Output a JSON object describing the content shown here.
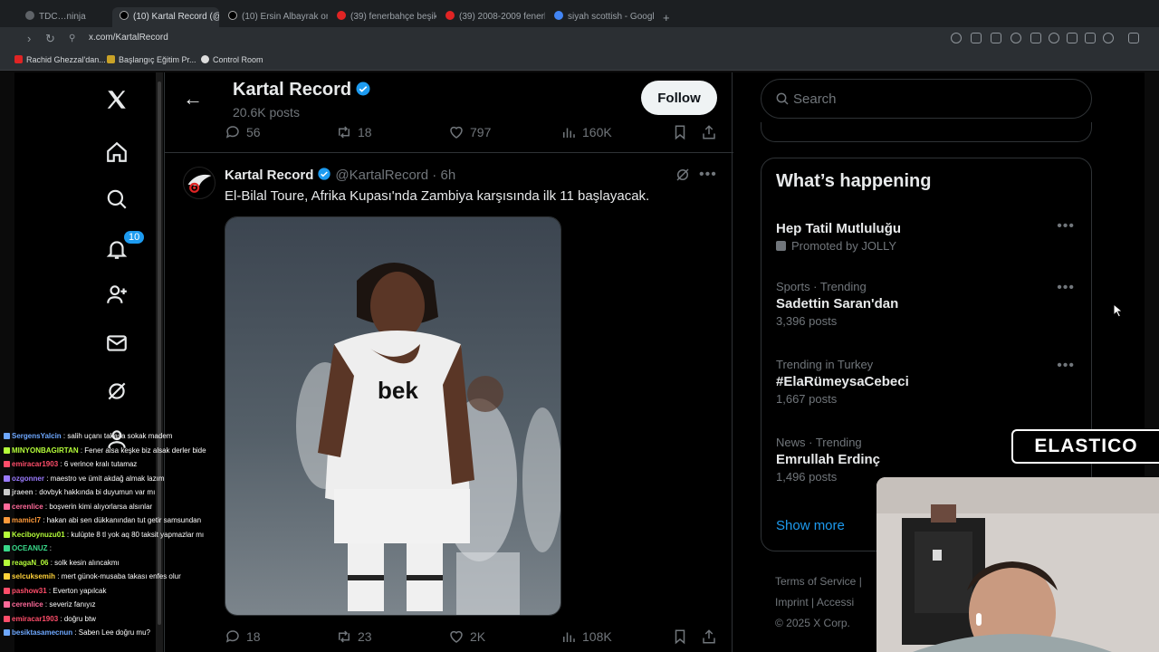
{
  "browser": {
    "tabs": [
      {
        "label": "TDC…ninja"
      },
      {
        "label": "(10) Kartal Record (@Ka…"
      },
      {
        "label": "(10) Ersin Albayrak on X…"
      },
      {
        "label": "(39) fenerbahçe beşikt…"
      },
      {
        "label": "(39) 2008-2009 fenerbah…"
      },
      {
        "label": "siyah scottish - Google…"
      }
    ],
    "url": "x.com/KartalRecord",
    "bookmarks": [
      "Rachid Ghezzal'dan...",
      "Başlangıç Eğitim Pr...",
      "Control Room"
    ]
  },
  "nav": {
    "notification_count": "10",
    "icons": [
      "x-logo-icon",
      "home-icon",
      "search-icon",
      "notifications-icon",
      "follow-icon",
      "messages-icon",
      "grok-icon",
      "profile-icon"
    ]
  },
  "header": {
    "title": "Kartal Record",
    "posts_count": "20.6K posts",
    "follow_label": "Follow"
  },
  "prev_post_actions": {
    "replies": "56",
    "reposts": "18",
    "likes": "797",
    "views": "160K"
  },
  "tweet": {
    "name": "Kartal Record",
    "handle": "@KartalRecord · 6h",
    "text": "El-Bilal Toure, Afrika Kupası'nda Zambiya karşısında ilk 11 başlayacak.",
    "actions": {
      "replies": "18",
      "reposts": "23",
      "likes": "2K",
      "views": "108K"
    }
  },
  "sidebar": {
    "search_placeholder": "Search",
    "whats_happening_title": "What’s happening",
    "trends": [
      {
        "meta": "",
        "label": "Hep Tatil Mutluluğu",
        "count": "Promoted by JOLLY"
      },
      {
        "meta": "Sports · Trending",
        "label": "Sadettin Saran'dan",
        "count": "3,396 posts"
      },
      {
        "meta": "Trending in Turkey",
        "label": "#ElaRümeysaCebeci",
        "count": "1,667 posts"
      },
      {
        "meta": "News · Trending",
        "label": "Emrullah Erdinç",
        "count": "1,496 posts"
      }
    ],
    "show_more": "Show more",
    "footer": {
      "terms": "Terms of Service",
      "imprint": "Imprint",
      "access": "Accessi",
      "copyright": "© 2025 X Corp."
    }
  },
  "stream": {
    "logo_text": "ELASTICO",
    "chat": [
      {
        "user": "SergensYalcin",
        "color": "#6ea8ff",
        "msg": ": salih uçanı takasa sokak madem"
      },
      {
        "user": "MINYONBAGIRTAN",
        "color": "#b6ff3a",
        "msg": ": Fener alsa keşke biz alsak derler bide"
      },
      {
        "user": "emiracar1903",
        "color": "#ff4d6a",
        "msg": ": 6 verince kralı tutamaz"
      },
      {
        "user": "ozgonner",
        "color": "#9b7bff",
        "msg": ": maestro ve ümit akdağ almak lazım"
      },
      {
        "user": "jraeen",
        "color": "#cccccc",
        "msg": ": dovbyk hakkında bi duyumun var mı"
      },
      {
        "user": "cerenlice",
        "color": "#ff6a9a",
        "msg": ": boşverin kimi alıyorlarsa alsınlar"
      },
      {
        "user": "mamicl7",
        "color": "#ff9a3a",
        "msg": ": hakan abi sen dükkanından tut getir samsundan"
      },
      {
        "user": "Keciboynuzu01",
        "color": "#b6ff3a",
        "msg": ": kulüpte 8 tl yok aq 80 taksit yapmazlar mı"
      },
      {
        "user": "OCEANUZ",
        "color": "#39d98a",
        "msg": ":"
      },
      {
        "user": "reagaN_06",
        "color": "#b6ff3a",
        "msg": ": solk kesin alıncakmı"
      },
      {
        "user": "selcuksemih",
        "color": "#ffd23a",
        "msg": ": mert günok-musaba takası enfes olur"
      },
      {
        "user": "pashow31",
        "color": "#ff4d6a",
        "msg": ": Everton yapılcak"
      },
      {
        "user": "cerenlice",
        "color": "#ff6a9a",
        "msg": ": severiz fanıyız"
      },
      {
        "user": "emiracar1903",
        "color": "#ff4d6a",
        "msg": ": doğru btw"
      },
      {
        "user": "besiktasamecnun",
        "color": "#6ea8ff",
        "msg": ": Saben Lee doğru mu?"
      }
    ]
  }
}
